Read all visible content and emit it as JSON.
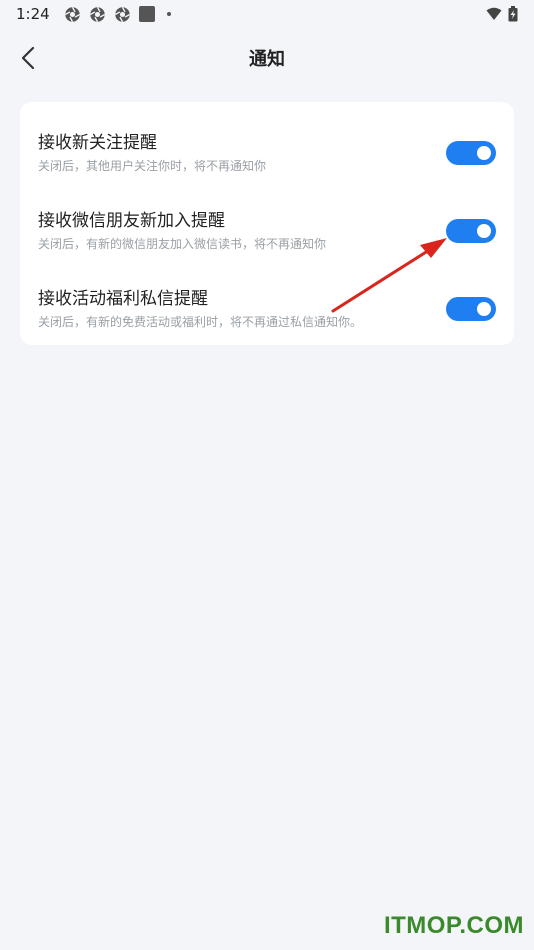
{
  "status_bar": {
    "time": "1:24"
  },
  "nav": {
    "title": "通知"
  },
  "settings": [
    {
      "title": "接收新关注提醒",
      "subtitle": "关闭后，其他用户关注你时，将不再通知你",
      "enabled": true
    },
    {
      "title": "接收微信朋友新加入提醒",
      "subtitle": "关闭后，有新的微信朋友加入微信读书，将不再通知你",
      "enabled": true
    },
    {
      "title": "接收活动福利私信提醒",
      "subtitle": "关闭后，有新的免费活动或福利时，将不再通过私信通知你。",
      "enabled": true
    }
  ],
  "colors": {
    "toggle_on": "#1f7ff0",
    "annotation_arrow": "#d9261c",
    "watermark": "#3a8a2c"
  },
  "watermark": {
    "text": "ITMOP.COM"
  }
}
